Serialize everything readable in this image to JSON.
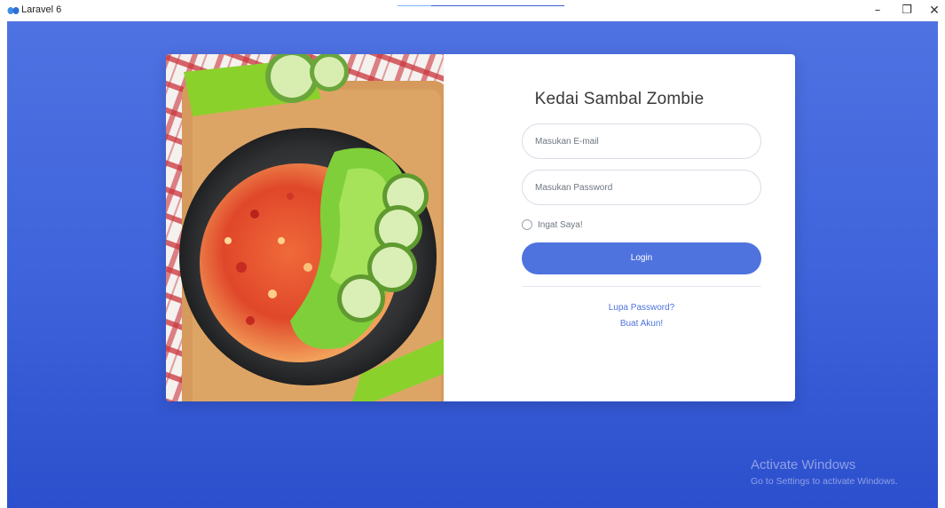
{
  "window": {
    "title": "Laravel 6",
    "icon": "laravel-logo-icon",
    "controls": {
      "minimize": "–",
      "maximize": "❐",
      "close": "✕"
    }
  },
  "colors": {
    "background_top": "#4f72e2",
    "background_bottom": "#2c4fcd",
    "primary": "#4e73df",
    "card": "#ffffff"
  },
  "login_card": {
    "image": "sambal-food-photo",
    "title": "Kedai Sambal Zombie",
    "email": {
      "value": "",
      "placeholder": "Masukan E-mail"
    },
    "password": {
      "value": "",
      "placeholder": "Masukan Password"
    },
    "remember_label": "Ingat Saya!",
    "remember_checked": false,
    "login_label": "Login",
    "forgot_password_label": "Lupa Password?",
    "create_account_label": "Buat Akun!"
  },
  "watermark": {
    "title": "Activate Windows",
    "subtitle": "Go to Settings to activate Windows."
  }
}
